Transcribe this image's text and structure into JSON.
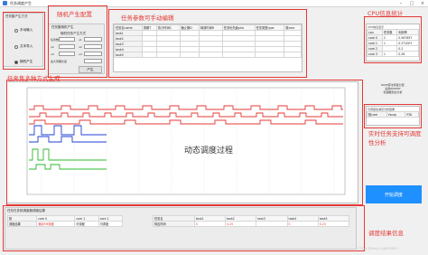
{
  "window": {
    "title": "任务调度产生"
  },
  "mode_group": {
    "title": "任务集产生方式",
    "options": [
      {
        "label": "手动输入",
        "selected": false
      },
      {
        "label": "文本导入",
        "selected": false
      },
      {
        "label": "随机产生",
        "selected": true
      }
    ]
  },
  "random_config": {
    "title": "任务集随机产生",
    "sub": "随机任务产生方式",
    "rows": [
      {
        "label": "任务数",
        "label2": "u1"
      },
      {
        "label": "u2",
        "label2": "u2"
      },
      {
        "label": "u3",
        "label2": "u3"
      }
    ],
    "max_period_label": "最大周期长度",
    "generate_button": "产生"
  },
  "param_table": {
    "headers": [
      "任务名name",
      "周期T",
      "执行时间C",
      "截止期D",
      "释放时间R",
      "任务优先级prio",
      "任务类型type",
      "核core"
    ],
    "rows": [
      "task1",
      "task2",
      "task3",
      "task4",
      "task5"
    ]
  },
  "cpu": {
    "box_title": "CPU信息显示",
    "headers": [
      "cpu",
      "任务数",
      "利用率"
    ],
    "rows": [
      [
        "core 0",
        "2",
        "0.567857"
      ],
      [
        "core 1",
        "1",
        "0.371007"
      ],
      [
        "core 2",
        "",
        "0.2"
      ],
      [
        "core 3",
        "1",
        "0.26"
      ]
    ]
  },
  "right_panel": {
    "info_lines": [
      "RM/E算法调度分配",
      "采用RM/EDF",
      "处理器到达分析"
    ],
    "rta_title": "可调度性满足分析结果",
    "rta_headers": [
      "核core",
      "Vscop",
      "RTA"
    ],
    "start_button": "开始调度"
  },
  "chart_center_label": "动态调度过程",
  "result": {
    "title": "任务在多核调度器调度结果",
    "core_headers": [
      "核",
      "core 0",
      "core 1",
      "core 2"
    ],
    "core_row": [
      "调度结果",
      "满足RM调度",
      "可调度",
      "可调度"
    ],
    "task_headers": [
      "任务名",
      "task1",
      "task2",
      "task3",
      "task4",
      "task5"
    ],
    "task_row": [
      "响应时间",
      "0",
      "0.25",
      "",
      "0",
      "0.25"
    ]
  },
  "annotations": {
    "random_config": "随机产生配置",
    "task_params": "任务参数可手动编辑",
    "cpu_stats": "CPU信息统计",
    "task_sets": "任务集多种方式生成",
    "realtime": [
      "实时任务支持可调度",
      "性分析"
    ],
    "result_info": "调度结果信息"
  },
  "watermark": "CSDN @ldbq-248899800",
  "colors": {
    "red": "#e53935",
    "accent_blue": "#1e90ff",
    "track_red": "#e53935",
    "track_blue": "#1f3fd6",
    "track_green": "#2eb82e"
  }
}
